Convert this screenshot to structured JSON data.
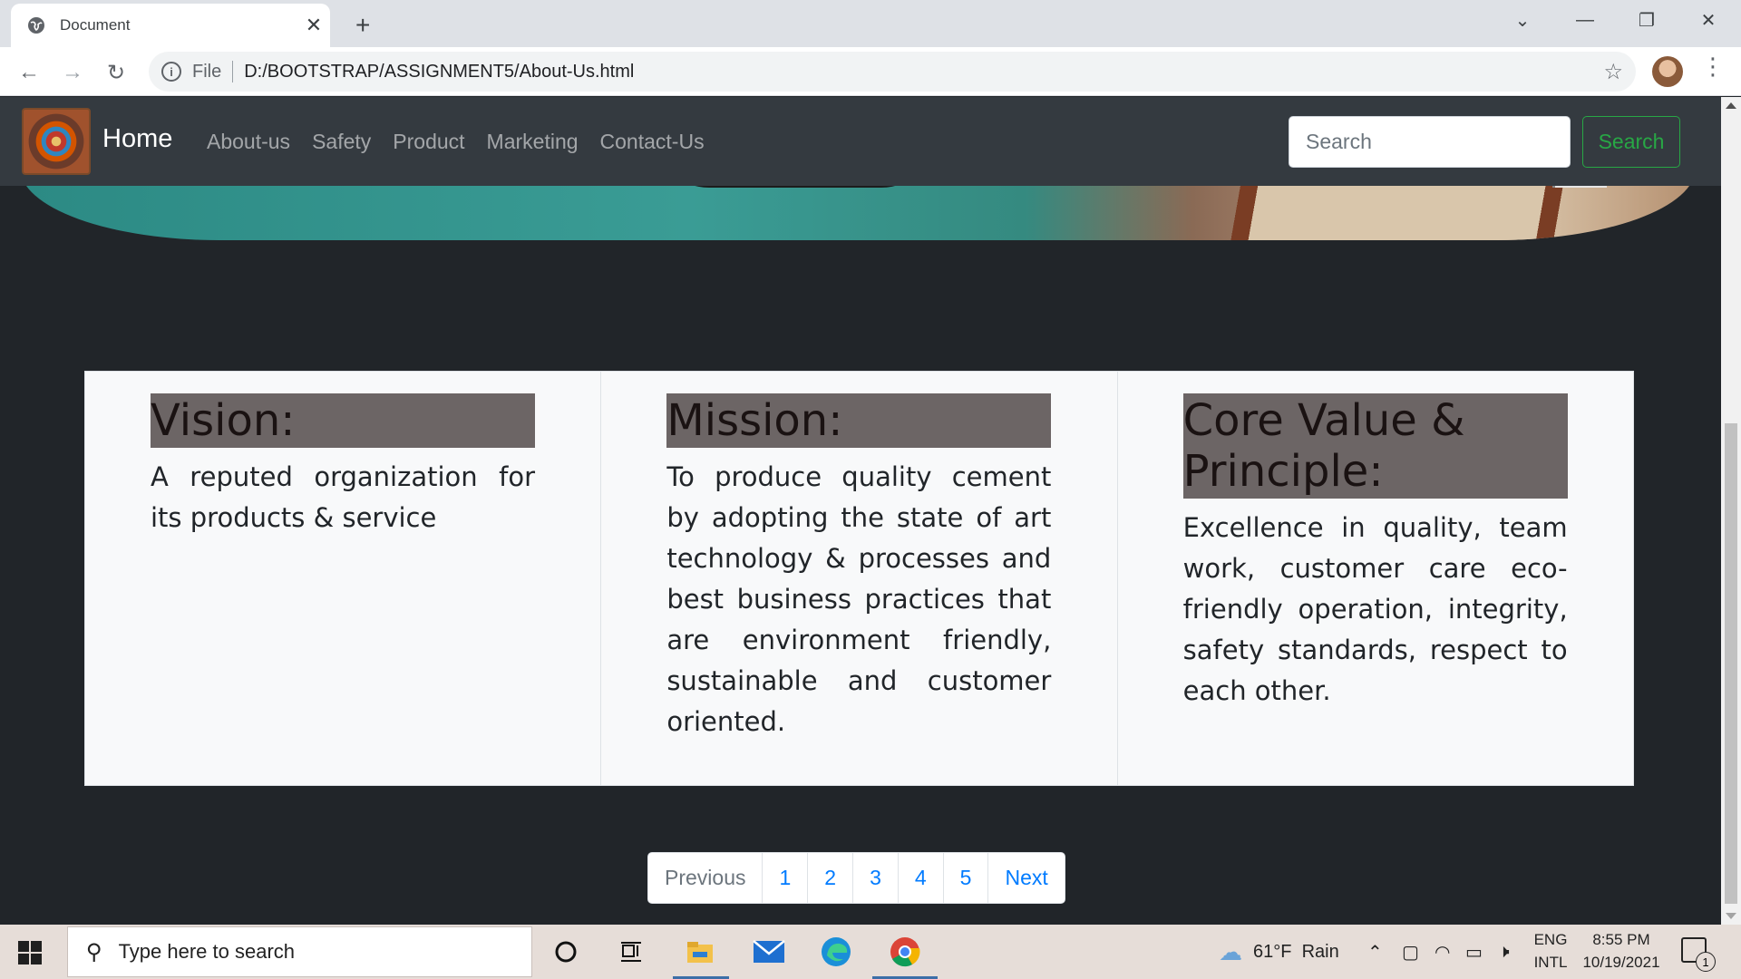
{
  "browser": {
    "tab_title": "Document",
    "tab_close": "✕",
    "new_tab": "+",
    "scheme": "File",
    "url": "D:/BOOTSTRAP/ASSIGNMENT5/About-Us.html",
    "icons": [
      "back-icon",
      "forward-icon",
      "reload-icon",
      "info-icon",
      "star-icon",
      "profile-avatar",
      "menu-icon"
    ]
  },
  "navbar": {
    "brand": "Home",
    "links": [
      "About-us",
      "Safety",
      "Product",
      "Marketing",
      "Contact-Us"
    ],
    "search_placeholder": "Search",
    "search_button": "Search",
    "search_button_color": "#28a745",
    "background": "#343a40"
  },
  "cards": [
    {
      "title": "Vision:",
      "text": "A reputed organization for its products & service"
    },
    {
      "title": "Mission:",
      "text": "To produce quality cement by adopting the state of art technology & processes and best business practices that are environment friendly, sustainable and customer oriented."
    },
    {
      "title": "Core Value & Principle:",
      "text": "Excellence in quality, team work, customer care eco-friendly operation, integrity, safety standards, respect to each other."
    }
  ],
  "pagination": {
    "previous": "Previous",
    "pages": [
      "1",
      "2",
      "3",
      "4",
      "5"
    ],
    "next": "Next",
    "link_color": "#007bff"
  },
  "taskbar": {
    "search_placeholder": "Type here to search",
    "weather": "61°F  Rain",
    "lang_top": "ENG",
    "lang_bottom": "INTL",
    "time": "8:55 PM",
    "date": "10/19/2021",
    "notification_count": "1",
    "icons": [
      "windows-start-icon",
      "search-icon",
      "cortana-icon",
      "task-view-icon",
      "file-explorer-icon",
      "mail-icon",
      "edge-icon",
      "chrome-icon",
      "weather-icon",
      "chevron-up-icon",
      "meet-icon",
      "wifi-icon",
      "battery-icon",
      "volume-muted-icon",
      "notification-icon"
    ]
  }
}
